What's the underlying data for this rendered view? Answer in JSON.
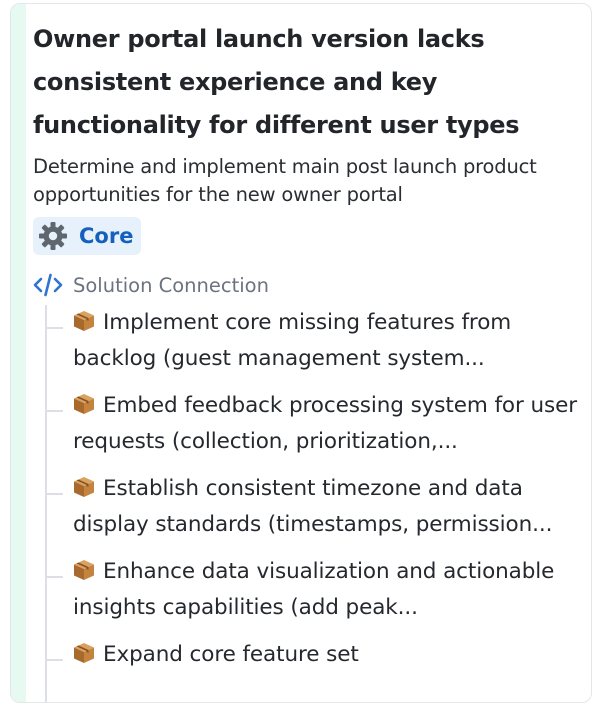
{
  "card": {
    "title": "Owner portal launch version lacks consistent experience and key functionality for different user types",
    "description": "Determine and implement main post launch product opportunities for the new owner portal",
    "tag": {
      "icon": "gear-icon",
      "label": "Core"
    },
    "accent_color": "#e6faf2"
  },
  "connection": {
    "icon": "code-icon",
    "label": "Solution Connection",
    "items": [
      {
        "icon": "package-icon",
        "text": "Implement core missing features from backlog (guest management system..."
      },
      {
        "icon": "package-icon",
        "text": "Embed feedback processing system for user requests (collection, prioritization,..."
      },
      {
        "icon": "package-icon",
        "text": "Establish consistent timezone and data display standards (timestamps, permission..."
      },
      {
        "icon": "package-icon",
        "text": "Enhance data visualization and actionable insights capabilities (add peak..."
      },
      {
        "icon": "package-icon",
        "text": "Expand core feature set"
      }
    ]
  }
}
